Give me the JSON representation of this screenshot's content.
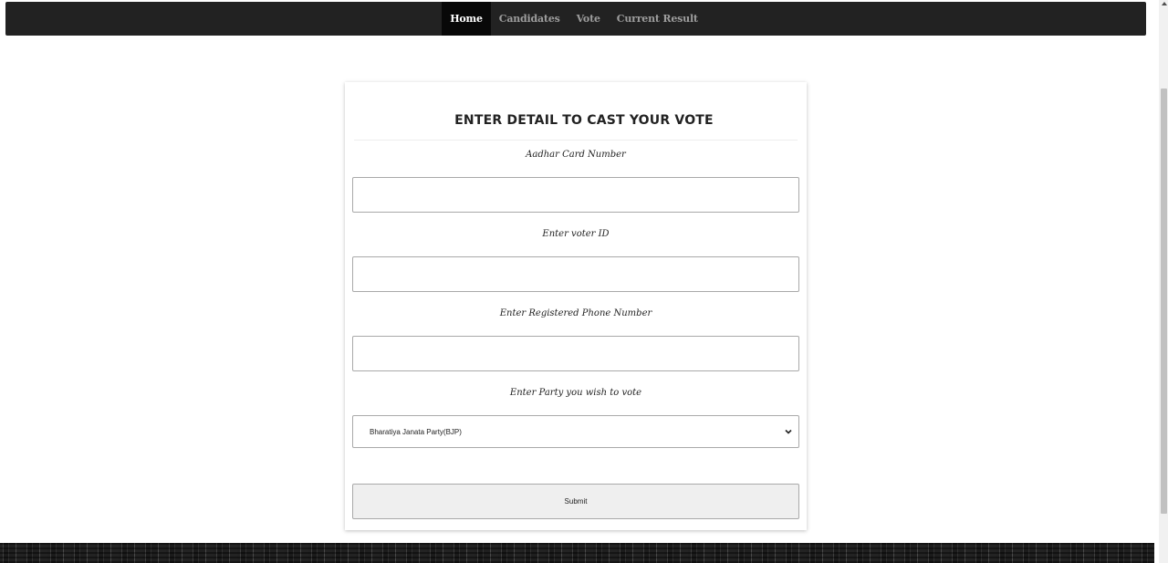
{
  "navbar": {
    "items": [
      {
        "label": "Home",
        "active": true
      },
      {
        "label": "Candidates",
        "active": false
      },
      {
        "label": "Vote",
        "active": false
      },
      {
        "label": "Current Result",
        "active": false
      }
    ]
  },
  "form": {
    "title": "ENTER DETAIL TO CAST YOUR VOTE",
    "aadhar_label": "Aadhar Card Number",
    "aadhar_value": "",
    "voter_id_label": "Enter voter ID",
    "voter_id_value": "",
    "phone_label": "Enter Registered Phone Number",
    "phone_value": "",
    "party_label": "Enter Party you wish to vote",
    "party_selected": "Bharatiya Janata Party(BJP)",
    "submit_label": "Submit"
  },
  "colors": {
    "navbar_bg": "#222222",
    "nav_active_bg": "#080808",
    "nav_text": "#9d9d9d",
    "nav_active_text": "#ffffff",
    "button_bg": "#efefef"
  },
  "icons": {
    "select_chevron": "chevron-down-icon",
    "scroll_up": "scroll-up-arrow-icon"
  }
}
